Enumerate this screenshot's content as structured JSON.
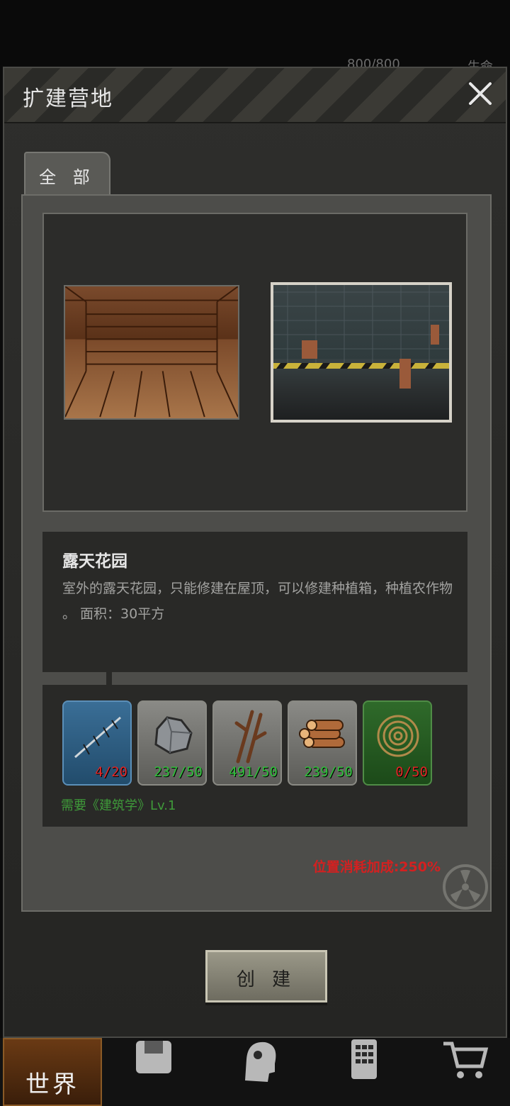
{
  "hud": {
    "health": "800/800",
    "right_label": "生命"
  },
  "modal": {
    "title": "扩建营地",
    "close_icon": "close-icon"
  },
  "tabs": [
    {
      "label": "全 部"
    }
  ],
  "building": {
    "name": "露天花园",
    "description": "室外的露天花园，只能修建在屋顶，可以修建种植箱，种植农作物 。 面积：30平方"
  },
  "resources": [
    {
      "icon": "barbed-wire-icon",
      "count": "4/20",
      "count_color": "#e02626",
      "style": "blue"
    },
    {
      "icon": "rock-icon",
      "count": "237/50",
      "count_color": "#2fbf3a",
      "style": "gray"
    },
    {
      "icon": "branches-icon",
      "count": "491/50",
      "count_color": "#2fbf3a",
      "style": "gray"
    },
    {
      "icon": "logs-icon",
      "count": "239/50",
      "count_color": "#2fbf3a",
      "style": "gray"
    },
    {
      "icon": "rope-icon",
      "count": "0/50",
      "count_color": "#e02626",
      "style": "green"
    }
  ],
  "requirement": "需要《建筑学》Lv.1",
  "bonus": "位置消耗加成:250%",
  "create_button": "创 建",
  "nav": {
    "world": "世界"
  }
}
